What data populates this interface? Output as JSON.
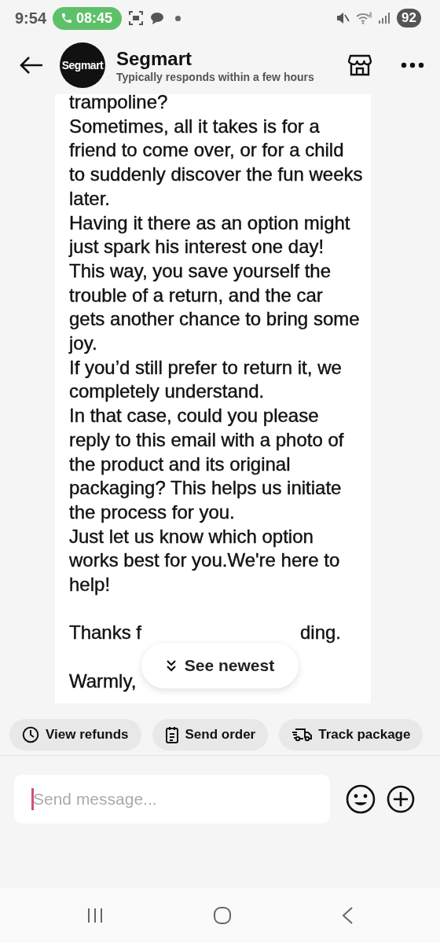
{
  "status_bar": {
    "time": "9:54",
    "call_timer": "08:45",
    "battery": "92"
  },
  "header": {
    "avatar_text": "Segmart",
    "name": "Segmart",
    "subtitle": "Typically responds within a few hours"
  },
  "message": {
    "paragraphs": [
      "trampoline?",
      "Sometimes, all it takes is for a friend to come over, or for a child to suddenly discover the fun weeks later.",
      "Having it there as an option might just spark his interest one day!",
      "This way, you save yourself the trouble of a return, and the car gets another chance to bring some joy.",
      "If you’d still prefer to return it, we completely understand.",
      "In that case, could you please reply to this email with a photo of the product and its original packaging? This helps us initiate the process for you.",
      "Just let us know which option works best for you.We're here to help!"
    ],
    "covered_line": {
      "before": "Thanks f",
      "after": "ding."
    },
    "closing": "Warmly,"
  },
  "see_newest": "See newest",
  "quick_actions": [
    {
      "kind": "clock",
      "label": "View refunds"
    },
    {
      "kind": "clipboard",
      "label": "Send order"
    },
    {
      "kind": "truck",
      "label": "Track package"
    }
  ],
  "composer": {
    "placeholder": "Send message..."
  }
}
